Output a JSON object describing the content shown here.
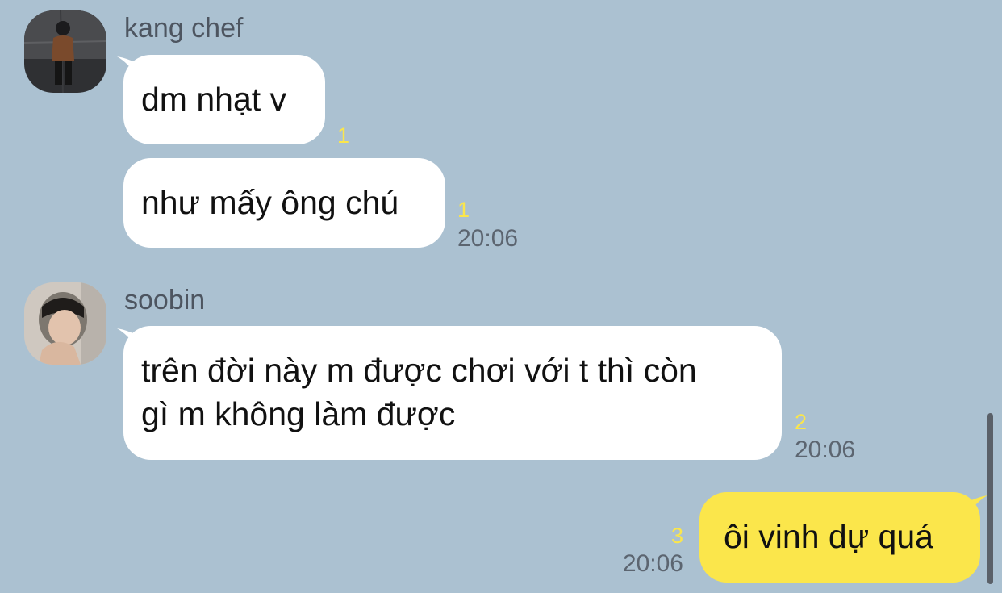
{
  "messages": [
    {
      "sender": "kang chef",
      "bubbles": [
        {
          "text": "dm nhạt v",
          "unread": "1",
          "time": ""
        },
        {
          "text": "như mấy ông chú",
          "unread": "1",
          "time": "20:06"
        }
      ]
    },
    {
      "sender": "soobin",
      "bubbles": [
        {
          "text": "trên đời này m được chơi với t thì còn\ngì m không làm được",
          "unread": "2",
          "time": "20:06"
        }
      ]
    }
  ],
  "outgoing": [
    {
      "text": "ôi vinh dự quá",
      "unread": "3",
      "time": "20:06"
    }
  ],
  "colors": {
    "background": "#abc1d1",
    "incoming_bubble": "#ffffff",
    "outgoing_bubble": "#fbe64b",
    "unread_count": "#fbe64b"
  }
}
